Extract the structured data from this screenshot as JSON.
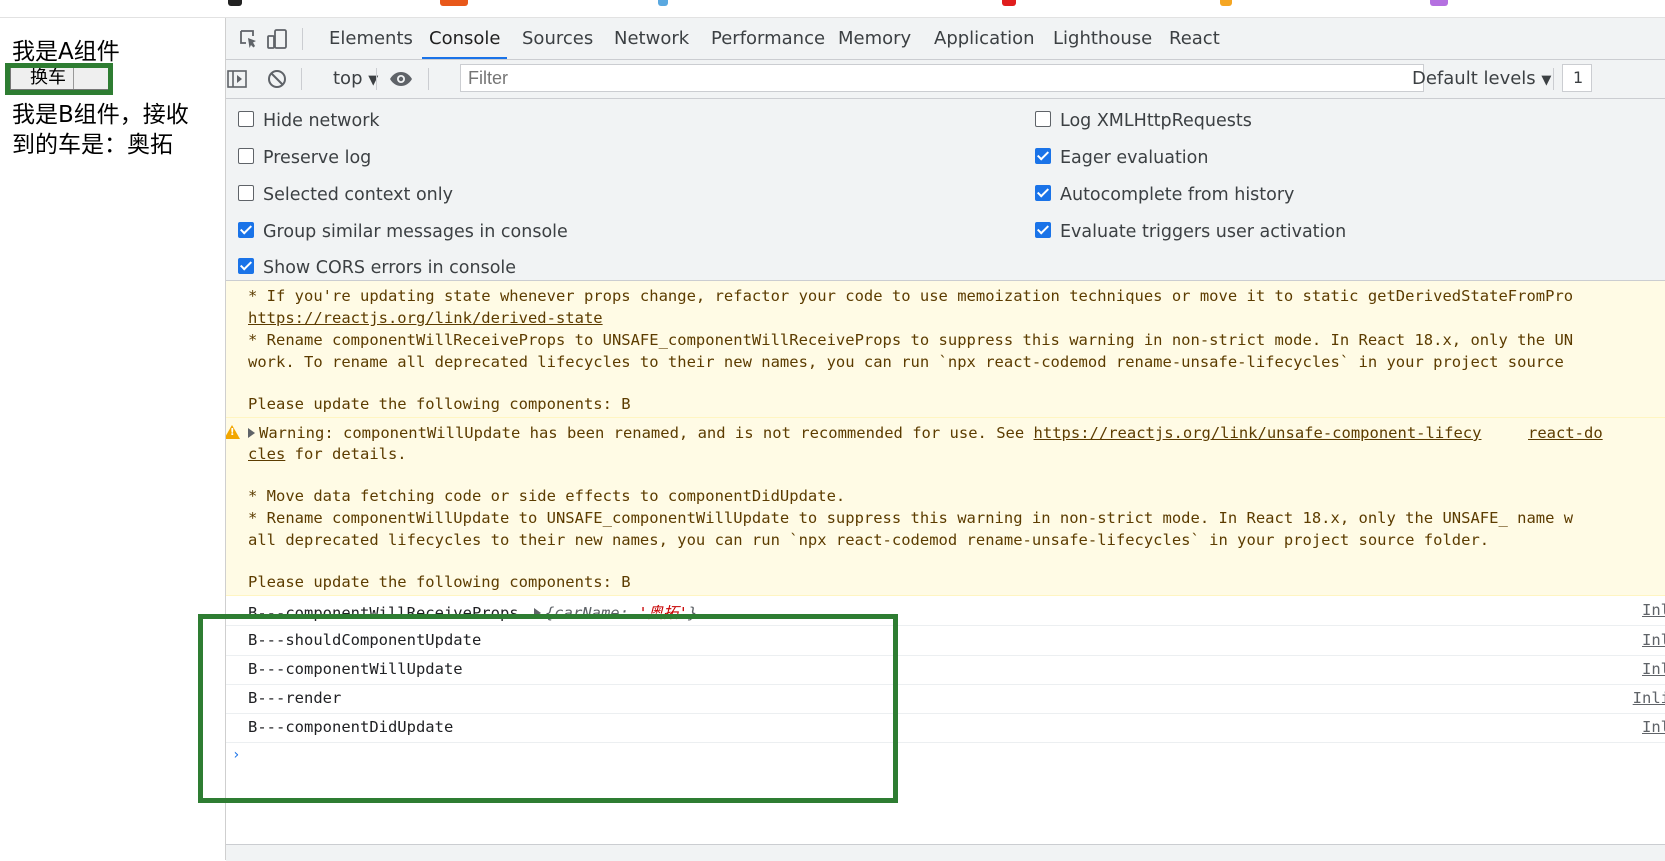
{
  "page": {
    "a_title": "我是A组件",
    "swap_button": "换车",
    "b_text_line1": "我是B组件，接收",
    "b_text_line2": "到的车是：奥拓"
  },
  "devtools": {
    "tabs": [
      "Elements",
      "Console",
      "Sources",
      "Network",
      "Performance",
      "Memory",
      "Application",
      "Lighthouse",
      "React"
    ],
    "active_tab": "Console",
    "toolbar": {
      "context": "top",
      "filter_placeholder": "Filter",
      "levels": "Default levels",
      "extra": "1"
    },
    "settings": {
      "left": [
        {
          "label": "Hide network",
          "checked": false
        },
        {
          "label": "Preserve log",
          "checked": false
        },
        {
          "label": "Selected context only",
          "checked": false
        },
        {
          "label": "Group similar messages in console",
          "checked": true
        },
        {
          "label": "Show CORS errors in console",
          "checked": true
        }
      ],
      "right": [
        {
          "label": "Log XMLHttpRequests",
          "checked": false
        },
        {
          "label": "Eager evaluation",
          "checked": true
        },
        {
          "label": "Autocomplete from history",
          "checked": true
        },
        {
          "label": "Evaluate triggers user activation",
          "checked": true
        }
      ]
    },
    "console": {
      "w1": {
        "l1": "* If you're updating state whenever props change, refactor your code to use memoization techniques or move it to static getDerivedStateFromPro",
        "l2": "https://reactjs.org/link/derived-state",
        "l3": "* Rename componentWillReceiveProps to UNSAFE_componentWillReceiveProps to suppress this warning in non-strict mode. In React 18.x, only the UN",
        "l4": "work. To rename all deprecated lifecycles to their new names, you can run `npx react-codemod rename-unsafe-lifecycles` in your project source",
        "l5": "Please update the following components: B"
      },
      "w2": {
        "l1a": "Warning: componentWillUpdate has been renamed, and is not recommended for use. See ",
        "l1link": "https://reactjs.org/link/unsafe-component-lifecy",
        "l1src": "react-do",
        "l2link": "cles",
        "l2b": " for details.",
        "l3": "* Move data fetching code or side effects to componentDidUpdate.",
        "l4": "* Rename componentWillUpdate to UNSAFE_componentWillUpdate to suppress this warning in non-strict mode. In React 18.x, only the UNSAFE_ name w",
        "l5": "all deprecated lifecycles to their new names, you can run `npx react-codemod rename-unsafe-lifecycles` in your project source folder.",
        "l6": "Please update the following components: B"
      },
      "logs": [
        {
          "text": "B---componentWillReceiveProps",
          "src": "Inl"
        },
        {
          "text": "B---shouldComponentUpdate",
          "src": "Inl"
        },
        {
          "text": "B---componentWillUpdate",
          "src": "Inl"
        },
        {
          "text": "B---render",
          "src": "Inli"
        },
        {
          "text": "B---componentDidUpdate",
          "src": "Inl"
        }
      ],
      "obj_open": "{",
      "obj_key": "carName",
      "obj_colon": ": ",
      "obj_value": "'奥拓'",
      "obj_close": "}",
      "drawer_label": "Console"
    }
  },
  "colors": {
    "highlight": "#2e7d32",
    "accent": "#1a73e8",
    "warning_bg": "#fffbe5"
  }
}
